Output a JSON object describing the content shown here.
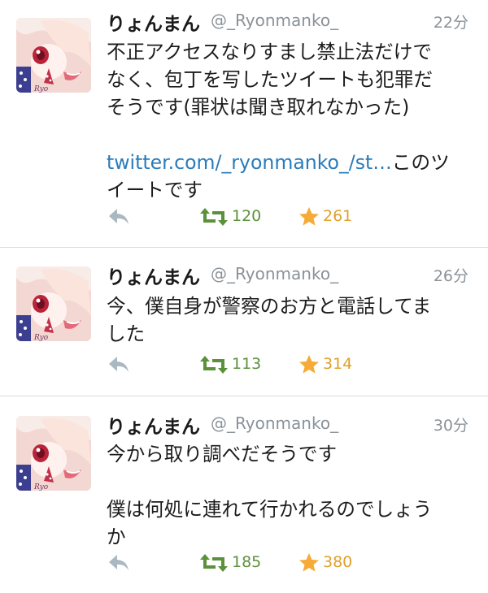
{
  "tweets": [
    {
      "name": "りょんまん",
      "handle": "@_Ryonmanko_",
      "time": "22分",
      "lines": [
        "不正アクセスなりすまし禁止法だけで",
        "なく、包丁を写したツイートも犯罪だ",
        "そうです(罪状は聞き取れなかった)"
      ],
      "link": "twitter.com/_ryonmanko_/st…",
      "after_link": "このツ",
      "last_line": "イートです",
      "retweets": "120",
      "favorites": "261"
    },
    {
      "name": "りょんまん",
      "handle": "@_Ryonmanko_",
      "time": "26分",
      "lines": [
        "今、僕自身が警察のお方と電話してま",
        "した"
      ],
      "retweets": "113",
      "favorites": "314"
    },
    {
      "name": "りょんまん",
      "handle": "@_Ryonmanko_",
      "time": "30分",
      "lines": [
        "今から取り調べだそうです"
      ],
      "lines2": [
        "僕は何処に連れて行かれるのでしょう",
        "か"
      ],
      "retweets": "185",
      "favorites": "380"
    }
  ],
  "colors": {
    "link": "#2b7bb9",
    "retweet": "#5c913b",
    "favorite": "#e0a02b",
    "meta": "#8a9299",
    "divider": "#d9dde1"
  },
  "icons": {
    "reply": "reply-icon",
    "retweet": "retweet-icon",
    "favorite": "star-icon",
    "avatar": "avatar"
  }
}
